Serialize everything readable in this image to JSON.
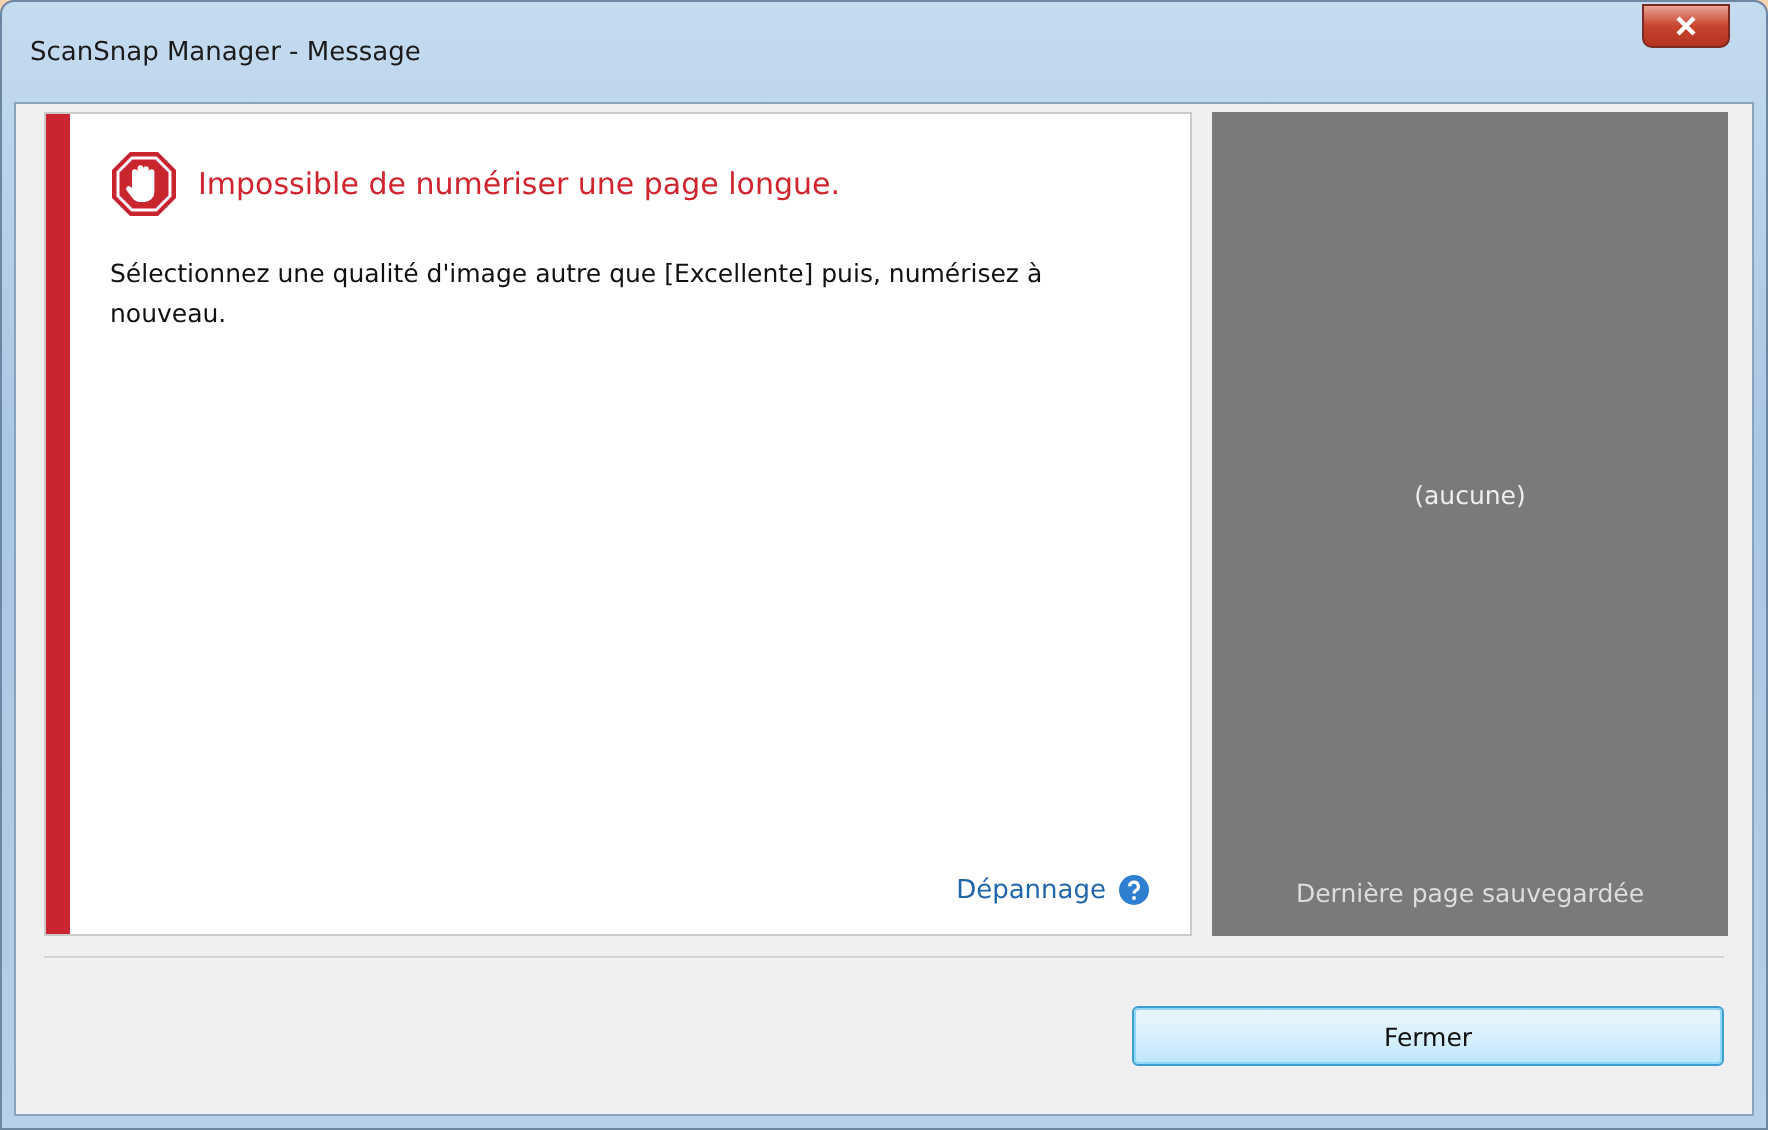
{
  "window": {
    "title": "ScanSnap Manager - Message"
  },
  "message": {
    "kind": "error",
    "heading": "Impossible de numériser une page longue.",
    "body": "Sélectionnez une qualité d'image autre que [Excellente] puis, numérisez à nouveau.",
    "help_link": "Dépannage"
  },
  "preview": {
    "placeholder": "(aucune)",
    "caption": "Dernière page sauvegardée"
  },
  "buttons": [
    {
      "label": "Fermer",
      "default": true
    }
  ]
}
